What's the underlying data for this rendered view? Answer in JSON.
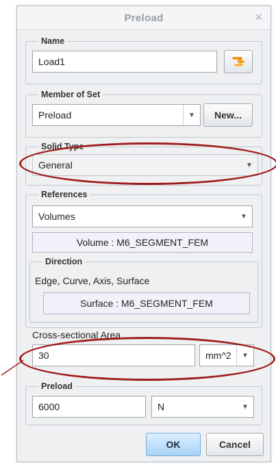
{
  "dialog": {
    "title": "Preload",
    "close_glyph": "×",
    "name": {
      "legend": "Name",
      "value": "Load1"
    },
    "member_of_set": {
      "legend": "Member of Set",
      "selected": "Preload",
      "new_button": "New..."
    },
    "solid_type": {
      "legend": "Solid Type",
      "selected": "General"
    },
    "references": {
      "legend": "References",
      "selected": "Volumes",
      "volume_ref": "Volume : M6_SEGMENT_FEM",
      "direction": {
        "legend": "Direction",
        "label": "Edge, Curve, Axis, Surface",
        "surface_ref": "Surface : M6_SEGMENT_FEM"
      }
    },
    "cross_section": {
      "label": "Cross-sectional Area",
      "value": "30",
      "unit": "mm^2"
    },
    "preload": {
      "legend": "Preload",
      "value": "6000",
      "unit": "N"
    },
    "ok_label": "OK",
    "cancel_label": "Cancel"
  },
  "icons": {
    "rename": "rename-icon",
    "dropdown": "chevron-down-icon",
    "close": "close-icon"
  },
  "colors": {
    "annotation": "#a01c1c",
    "ok_button": "#a8d3f8",
    "reference_box": "#f4f0fa"
  }
}
